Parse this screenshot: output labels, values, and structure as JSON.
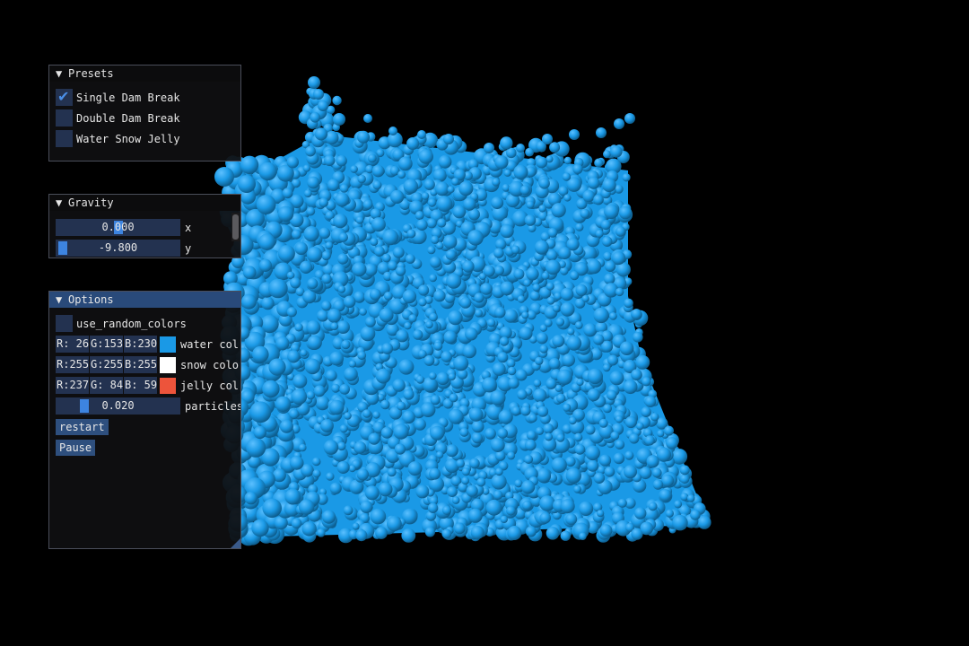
{
  "colors": {
    "water": "#1a99e6",
    "water_dark": "#0d5e8f",
    "snow": "#ffffff",
    "jelly": "#ed543b",
    "accent": "#3d84e0",
    "frame_bg": "#233250"
  },
  "presets": {
    "title": "Presets",
    "items": [
      {
        "label": "Single Dam Break",
        "checked": true
      },
      {
        "label": "Double Dam Break",
        "checked": false
      },
      {
        "label": "Water Snow Jelly",
        "checked": false
      }
    ]
  },
  "gravity": {
    "title": "Gravity",
    "x": {
      "value": "0.000",
      "axis": "x",
      "fraction": 0.5
    },
    "y": {
      "value": "-9.800",
      "axis": "y",
      "fraction": 0.01
    }
  },
  "options": {
    "title": "Options",
    "use_random_colors": {
      "label": "use_random_colors",
      "checked": false
    },
    "water": {
      "r": "R: 26",
      "g": "G:153",
      "b": "B:230",
      "label": "water col"
    },
    "snow": {
      "r": "R:255",
      "g": "G:255",
      "b": "B:255",
      "label": "snow colo"
    },
    "jelly": {
      "r": "R:237",
      "g": "G: 84",
      "b": "B: 59",
      "label": "jelly col"
    },
    "particles": {
      "value": "0.020",
      "label": "particles",
      "fraction": 0.2
    },
    "restart_label": "restart",
    "pause_label": "Pause"
  },
  "icons": {
    "collapse": "▼",
    "check": "✔"
  }
}
